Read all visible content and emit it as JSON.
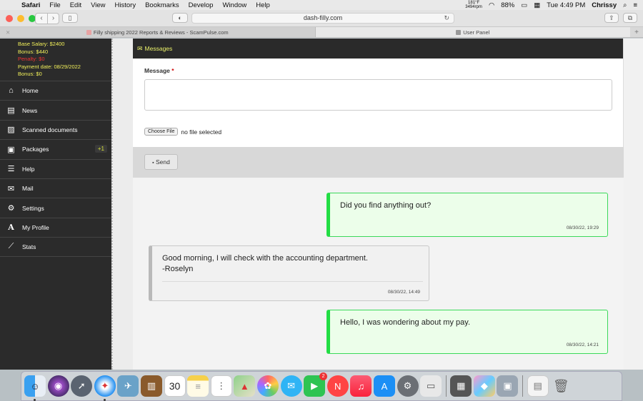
{
  "menubar": {
    "app": "Safari",
    "items": [
      "File",
      "Edit",
      "View",
      "History",
      "Bookmarks",
      "Develop",
      "Window",
      "Help"
    ],
    "temp": "181°F",
    "rpm": "3494rpm",
    "battery": "88%",
    "clock": "Tue 4:49 PM",
    "user": "Chrissy"
  },
  "browser": {
    "url": "dash-filly.com",
    "tabs": [
      {
        "label": "Filly shipping 2022 Reports & Reviews - ScamPulse.com"
      },
      {
        "label": "User Panel"
      }
    ]
  },
  "account": {
    "base_salary": "Base Salary: $2400",
    "bonus": "Bonus: $440",
    "penalty": "Penalty: $0",
    "payment_date": "Payment date: 08/29/2022",
    "bonus2": "Bonus: $0"
  },
  "nav": [
    {
      "label": "Home",
      "icon": "home-icon",
      "glyph": "⌂"
    },
    {
      "label": "News",
      "icon": "newspaper-icon",
      "glyph": "▤"
    },
    {
      "label": "Scanned documents",
      "icon": "documents-icon",
      "glyph": "▨"
    },
    {
      "label": "Packages",
      "icon": "package-icon",
      "glyph": "▣",
      "badge": "+1"
    },
    {
      "label": "Help",
      "icon": "list-icon",
      "glyph": "☰"
    },
    {
      "label": "Mail",
      "icon": "mail-icon",
      "glyph": "✉"
    },
    {
      "label": "Settings",
      "icon": "gear-icon",
      "glyph": "⚙"
    },
    {
      "label": "My Profile",
      "icon": "profile-icon",
      "glyph": "A"
    },
    {
      "label": "Stats",
      "icon": "chart-icon",
      "glyph": "⟋"
    }
  ],
  "panel": {
    "title": "Messages",
    "message_label": "Message",
    "required_mark": "*",
    "choose_file": "Choose File",
    "no_file": "no file selected",
    "send": "Send"
  },
  "messages": [
    {
      "direction": "out",
      "text": "Did you find anything out?",
      "time": "08/30/22, 19:29"
    },
    {
      "direction": "in",
      "text": "Good morning, I will check with the accounting department.\n-Roselyn",
      "time": "08/30/22, 14:49"
    },
    {
      "direction": "out",
      "text": "Hello, I was wondering about my pay.",
      "time": "08/30/22, 14:21"
    }
  ],
  "dock": {
    "calendar_day": "30",
    "facetime_badge": "2",
    "icons": [
      "finder-icon",
      "siri-icon",
      "launchpad-icon",
      "safari-icon",
      "preview-icon",
      "notes-book-icon",
      "calendar-icon",
      "notes-icon",
      "reminders-icon",
      "maps-icon",
      "photos-icon",
      "messages-icon",
      "facetime-icon",
      "news-icon",
      "music-icon",
      "app-store-icon",
      "system-preferences-icon",
      "keyboard-icon",
      "calculator-icon",
      "instruments-icon",
      "image-capture-icon",
      "document-icon",
      "trash-icon"
    ]
  },
  "colors": {
    "sidebar_bg": "#2b2b2b",
    "accent_yellow": "#e9f06a",
    "outgoing_border": "#22dd44",
    "outgoing_bg": "#ecfeea"
  }
}
